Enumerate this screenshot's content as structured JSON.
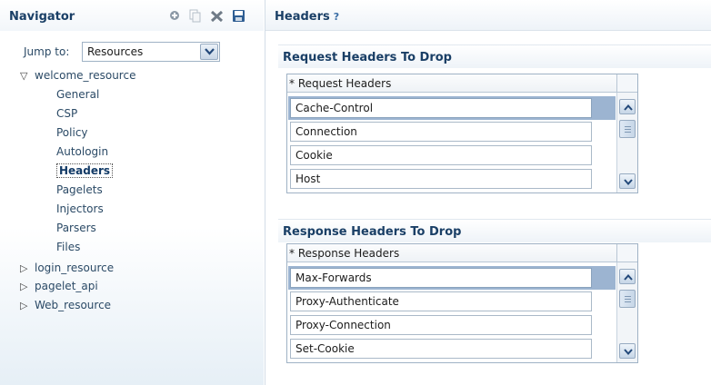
{
  "navigator": {
    "title": "Navigator",
    "toolbar": [
      {
        "icon": "add-icon",
        "label": ""
      },
      {
        "icon": "copy-icon",
        "label": ""
      },
      {
        "icon": "delete-icon",
        "label": ""
      },
      {
        "icon": "save-icon",
        "label": ""
      }
    ],
    "jump_to": {
      "label": "Jump to:",
      "selected": "Resources"
    },
    "tree": [
      {
        "label": "welcome_resource",
        "expanded": true,
        "children": [
          {
            "label": "General"
          },
          {
            "label": "CSP"
          },
          {
            "label": "Policy"
          },
          {
            "label": "Autologin"
          },
          {
            "label": "Headers",
            "selected": true
          },
          {
            "label": "Pagelets"
          },
          {
            "label": "Injectors"
          },
          {
            "label": "Parsers"
          },
          {
            "label": "Files"
          }
        ]
      },
      {
        "label": "login_resource",
        "expanded": false
      },
      {
        "label": "pagelet_api",
        "expanded": false
      },
      {
        "label": "Web_resource",
        "expanded": false
      }
    ]
  },
  "content": {
    "title": "Headers",
    "help_icon": "?",
    "request_section": {
      "title": "Request Headers To Drop",
      "column_header": "Request Headers",
      "required_marker": "*",
      "rows": [
        "Cache-Control",
        "Connection",
        "Cookie",
        "Host"
      ],
      "selected_row": 0
    },
    "response_section": {
      "title": "Response Headers To Drop",
      "column_header": "Response Headers",
      "required_marker": "*",
      "rows": [
        "Max-Forwards",
        "Proxy-Authenticate",
        "Proxy-Connection",
        "Set-Cookie"
      ],
      "selected_row": 0
    }
  },
  "colors": {
    "title_text": "#1a3f66",
    "selected_row": "#9cb4d1",
    "border": "#9fb2c5"
  }
}
